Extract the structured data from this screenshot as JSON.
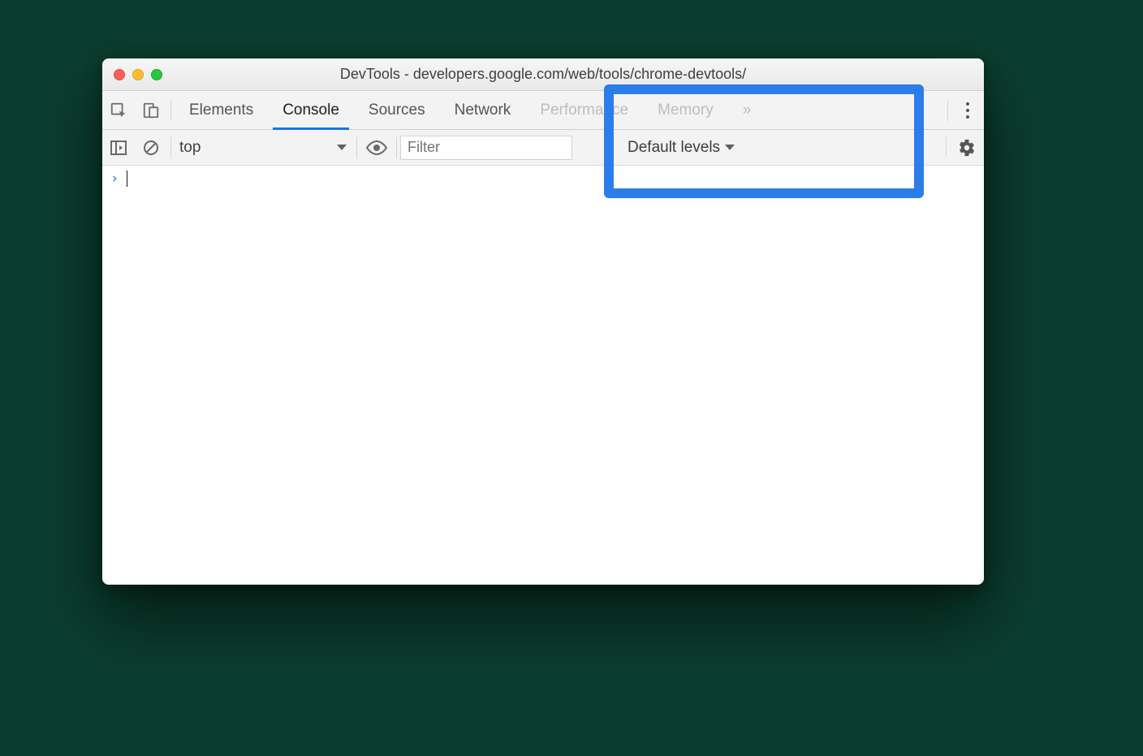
{
  "titlebar": {
    "title": "DevTools - developers.google.com/web/tools/chrome-devtools/"
  },
  "tabs": {
    "elements": "Elements",
    "console": "Console",
    "sources": "Sources",
    "network": "Network",
    "performance": "Performance",
    "memory": "Memory",
    "more": "»"
  },
  "console_toolbar": {
    "context": "top",
    "filter_placeholder": "Filter",
    "levels": "Default levels"
  },
  "prompt": {
    "symbol": "›"
  }
}
